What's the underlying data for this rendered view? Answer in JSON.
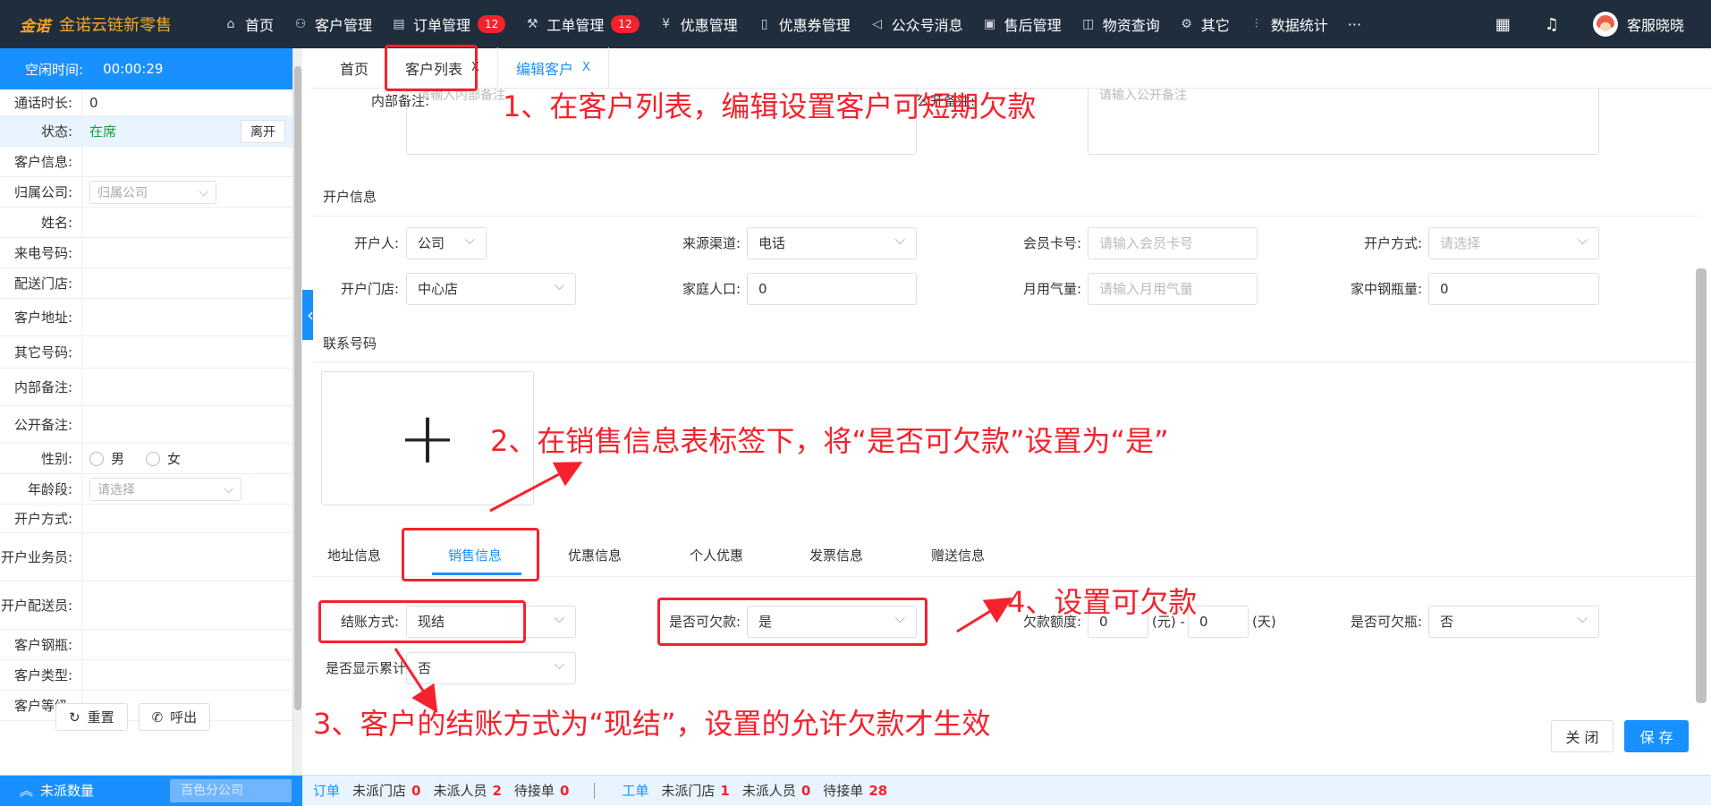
{
  "topnav": {
    "logo_mark": "金诺",
    "logo_name": "金诺云链新零售",
    "items": [
      {
        "label": "首页",
        "icon": "home-icon"
      },
      {
        "label": "客户管理",
        "icon": "users-icon"
      },
      {
        "label": "订单管理",
        "icon": "order-icon",
        "badge": "12"
      },
      {
        "label": "工单管理",
        "icon": "wrench-icon",
        "badge": "12"
      },
      {
        "label": "优惠管理",
        "icon": "yen-icon"
      },
      {
        "label": "优惠券管理",
        "icon": "coupon-icon"
      },
      {
        "label": "公众号消息",
        "icon": "megaphone-icon"
      },
      {
        "label": "售后管理",
        "icon": "aftersale-icon"
      },
      {
        "label": "物资查询",
        "icon": "box-icon"
      },
      {
        "label": "其它",
        "icon": "gear-icon"
      },
      {
        "label": "数据统计",
        "icon": "chart-icon"
      }
    ],
    "more": "···",
    "user_name": "客服晓晓"
  },
  "left": {
    "idle_label": "空闲时间:",
    "idle_time": "00:00:29",
    "call_duration_label": "通话时长:",
    "call_duration": "0",
    "status_label": "状态:",
    "status": "在席",
    "leave_button": "离开",
    "customer_info_label": "客户信息:",
    "company_label": "归属公司:",
    "company_placeholder": "归属公司",
    "name_label": "姓名:",
    "phone_label": "来电号码:",
    "store_label": "配送门店:",
    "address_label": "客户地址:",
    "other_phone_label": "其它号码:",
    "internal_note_label": "内部备注:",
    "public_note_label": "公开备注:",
    "gender_label": "性别:",
    "gender_male": "男",
    "gender_female": "女",
    "age_label": "年龄段:",
    "age_placeholder": "请选择",
    "open_method_label": "开户方式:",
    "open_staff_label": "开户业务员:",
    "open_delivery_label": "开户配送员:",
    "cylinder_label": "客户钢瓶:",
    "type_label": "客户类型:",
    "level_label": "客户等级:",
    "reset_button": "重置",
    "call_button": "呼出"
  },
  "tabs": [
    {
      "label": "首页"
    },
    {
      "label": "客户列表",
      "close": "X"
    },
    {
      "label": "编辑客户",
      "close": "X"
    }
  ],
  "form": {
    "internal_note_label": "内部备注:",
    "internal_note_placeholder": "请输入内部备注",
    "public_note_label": "公开备注:",
    "public_note_placeholder": "请输入公开备注",
    "open_section": "开户信息",
    "opener_label": "开户人:",
    "opener_value": "公司",
    "source_label": "来源渠道:",
    "source_value": "电话",
    "member_label": "会员卡号:",
    "member_placeholder": "请输入会员卡号",
    "open_way_label": "开户方式:",
    "open_way_placeholder": "请选择",
    "open_store_label": "开户门店:",
    "open_store_value": "中心店",
    "family_label": "家庭人口:",
    "family_value": "0",
    "gas_label": "月用气量:",
    "gas_placeholder": "请输入月用气量",
    "home_cyl_label": "家中钢瓶量:",
    "home_cyl_value": "0",
    "contact_section": "联系号码",
    "upload_plus": "+",
    "subtabs": [
      "地址信息",
      "销售信息",
      "优惠信息",
      "个人优惠",
      "发票信息",
      "赠送信息"
    ],
    "settle_label": "结账方式:",
    "settle_value": "现结",
    "credit_label": "是否可欠款:",
    "credit_value": "是",
    "limit_label": "欠款额度:",
    "limit_amount": "0",
    "limit_amount_unit": "(元) -",
    "limit_days": "0",
    "limit_days_unit": "(天)",
    "cyl_credit_label": "是否可欠瓶:",
    "cyl_credit_value": "否",
    "show_total_label": "是否显示累计",
    "show_total_value": "否",
    "close_button": "关 闭",
    "save_button": "保 存"
  },
  "annotations": {
    "a1": "1、在客户列表，编辑设置客户可短期欠款",
    "a2": "2、在销售信息表标签下，将“是否可欠款”设置为“是”",
    "a3": "3、客户的结账方式为“现结”，设置的允许欠款才生效",
    "a4": "4、设置可欠款"
  },
  "bottombar": {
    "undispatched": "未派数量",
    "company": "百色分公司",
    "order_label": "订单",
    "order_store_label": "未派门店",
    "order_store": "0",
    "order_staff_label": "未派人员",
    "order_staff": "2",
    "order_pending_label": "待接单",
    "order_pending": "0",
    "ticket_label": "工单",
    "ticket_store_label": "未派门店",
    "ticket_store": "1",
    "ticket_staff_label": "未派人员",
    "ticket_staff": "0",
    "ticket_pending_label": "待接单",
    "ticket_pending": "28"
  },
  "colors": {
    "nav_bg": "#1f2d3d",
    "accent": "#1890ff",
    "annotation": "#f5222d"
  }
}
